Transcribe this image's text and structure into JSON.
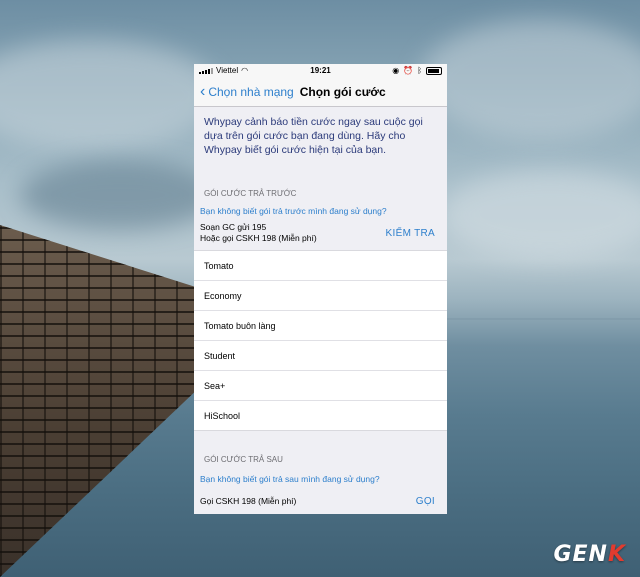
{
  "status_bar": {
    "carrier": "Viettel",
    "time": "19:21"
  },
  "nav": {
    "back_label": "Chọn nhà mạng",
    "title": "Chọn gói cước"
  },
  "intro_text": "Whypay cảnh báo tiền cước ngay sau cuộc gọi dựa trên gói cước bạn đang dùng. Hãy cho Whypay biết gói cước hiện tại của bạn.",
  "prepaid": {
    "header": "GÓI CƯỚC TRẢ TRƯỚC",
    "help_link": "Bạn không biết gói trả trước mình đang sử dụng?",
    "check_line1": "Soạn GC gửi 195",
    "check_line2": "Hoặc gọi CSKH 198 (Miễn phí)",
    "check_button": "KIỂM TRA",
    "plans": [
      {
        "label": "Tomato"
      },
      {
        "label": "Economy"
      },
      {
        "label": "Tomato buôn làng"
      },
      {
        "label": "Student"
      },
      {
        "label": "Sea+"
      },
      {
        "label": "HiSchool"
      }
    ]
  },
  "postpaid": {
    "header": "GÓI CƯỚC TRẢ SAU",
    "help_link": "Bạn không biết gói trả sau mình đang sử dụng?",
    "call_text": "Gọi CSKH 198 (Miễn phí)",
    "call_button": "GỌI"
  },
  "watermark": {
    "text_main": "GEN",
    "text_accent": "K"
  },
  "colors": {
    "accent": "#2d7fcc",
    "intro_text": "#2b3a7a",
    "screen_bg": "#efeff4"
  }
}
